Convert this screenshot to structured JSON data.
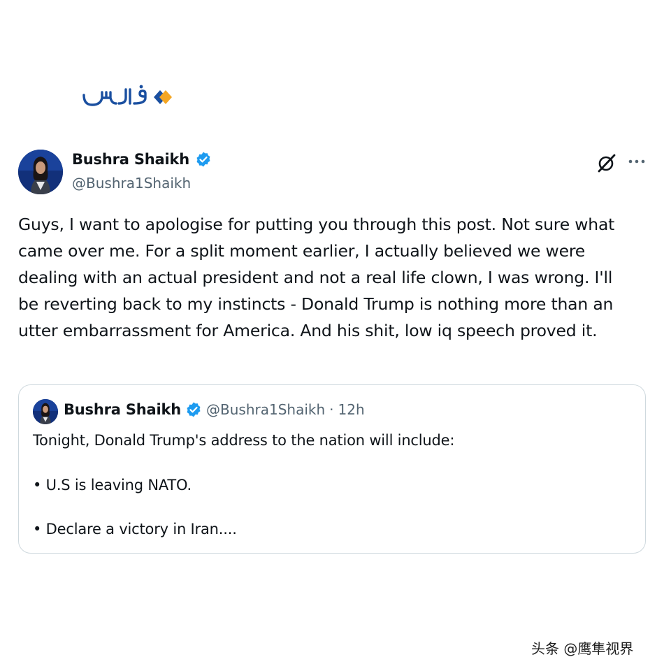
{
  "logo": {
    "text": "فارس"
  },
  "post": {
    "author_name": "Bushra Shaikh",
    "author_handle": "@Bushra1Shaikh",
    "text": "Guys, I want to apologise for putting you through this post. Not sure what came over me. For a split moment earlier, I actually believed we were dealing with an actual president and not a real life clown, I was wrong. I'll be reverting back to my instincts - Donald Trump is nothing more than an utter embarrassment for America. And his shit, low iq speech proved it."
  },
  "quoted_post": {
    "author_name": "Bushra Shaikh",
    "author_handle": "@Bushra1Shaikh",
    "separator": "·",
    "time": "12h",
    "lines": [
      "Tonight, Donald Trump's address to the nation will include:",
      "• U.S is leaving NATO.",
      "• Declare a victory in Iran...."
    ]
  },
  "watermark": "头条 @鹰隼视界",
  "colors": {
    "verified": "#1d9bf0",
    "secondary_text": "#536471",
    "logo_blue": "#1a4fa0",
    "logo_orange": "#f5a623"
  },
  "icons": [
    "verified-badge-icon",
    "grok-icon",
    "more-options-icon"
  ]
}
